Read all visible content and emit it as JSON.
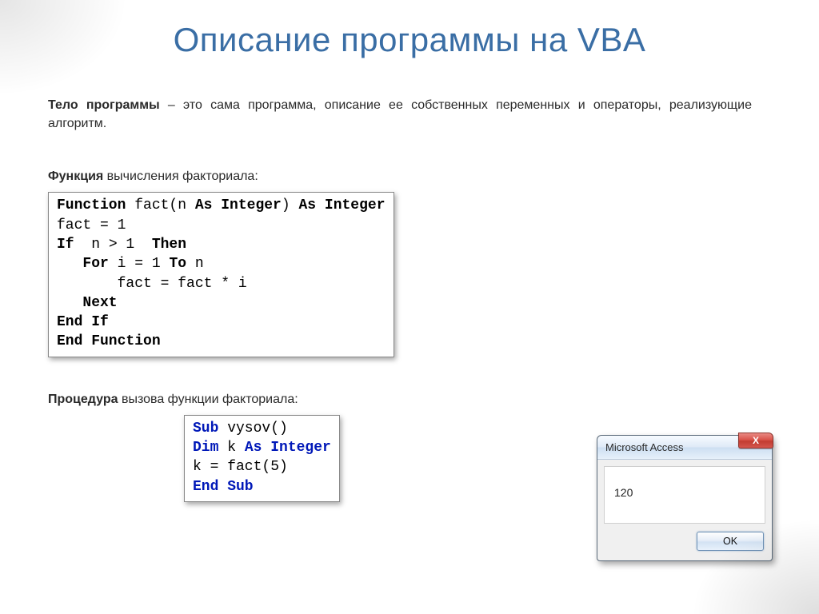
{
  "title": "Описание программы на VBA",
  "intro": {
    "bold": "Тело программы",
    "rest": " – это сама программа, описание ее собственных переменных и операторы, реализующие алгоритм."
  },
  "sub1": {
    "bold": "Функция",
    "rest": " вычисления факториала:"
  },
  "code1": {
    "l1a": "Function",
    "l1b": " fact(n ",
    "l1c": "As Integer",
    "l1d": ") ",
    "l1e": "As Integer",
    "l2": "fact = 1",
    "l3a": "If",
    "l3b": "  n > 1  ",
    "l3c": "Then",
    "l4a": "   For",
    "l4b": " i = 1 ",
    "l4c": "To",
    "l4d": " n",
    "l5": "       fact = fact * i",
    "l6": "   Next",
    "l7": "End If",
    "l8": "End Function"
  },
  "sub2": {
    "bold": "Процедура",
    "rest": " вызова функции факториала:"
  },
  "code2": {
    "l1a": "Sub",
    "l1b": " vysov()",
    "l2a": "Dim",
    "l2b": " k ",
    "l2c": "As Integer",
    "l3": "k = fact(5)",
    "l4": "End Sub"
  },
  "dialog": {
    "title": "Microsoft Access",
    "close": "X",
    "value": "120",
    "ok": "OK"
  }
}
